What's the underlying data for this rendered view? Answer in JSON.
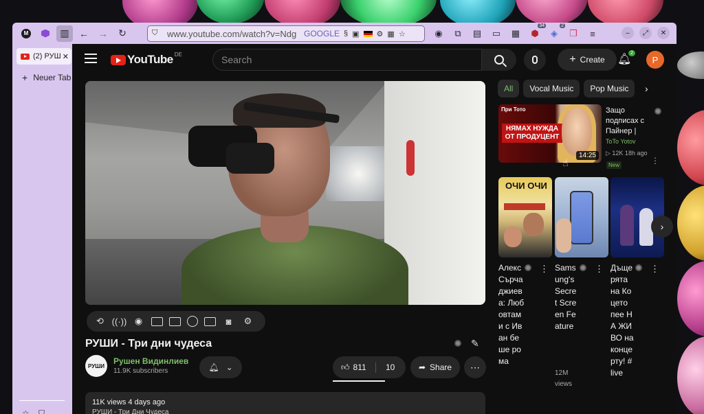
{
  "browser": {
    "url": "www.youtube.com/watch?v=Ndg",
    "search_engine": "GOOGLE",
    "ext_badge": "34",
    "ext_badge2": "2"
  },
  "sidebar": {
    "active_tab": "(2) РУШ",
    "new_tab": "Neuer Tab"
  },
  "header": {
    "logo": "YouTube",
    "region": "DE",
    "search_placeholder": "Search",
    "create_label": "Create",
    "notifications": "2",
    "avatar_letter": "P"
  },
  "video": {
    "title": "РУШИ - Три дни чудеса",
    "channel_avatar_text": "РУШИ",
    "channel": "Рушен Видинлиев",
    "subscribers": "11.9K subscribers",
    "likes": "811",
    "dislikes": "10",
    "share_label": "Share",
    "views_meta": "11K views  4 days ago",
    "desc_line": "РУШИ - Три Дни Чудеса"
  },
  "chips": [
    "All",
    "Vocal Music",
    "Pop Music"
  ],
  "recommended": {
    "brand": "При Тото",
    "caption": "НЯМАХ НУЖДА ОТ ПРОДУЦЕНТ",
    "duration": "14:25",
    "title": "Защо подписах с Пайнер |",
    "channel": "ToTo Yotov",
    "meta": "▷ 12K  18h ago",
    "new_label": "New"
  },
  "shorts": [
    {
      "thumb_text": "ОЧИ ОЧИ",
      "title": "Алекс Сърчаджиева: Любовтами с Иван беше рома"
    },
    {
      "thumb_text": "",
      "title": "Samsung's Secret Screen Feature",
      "views": "12M views"
    },
    {
      "thumb_text": "",
      "title": "Дъщерята на Коцето пее НА ЖИВО на концерту! #live"
    }
  ]
}
